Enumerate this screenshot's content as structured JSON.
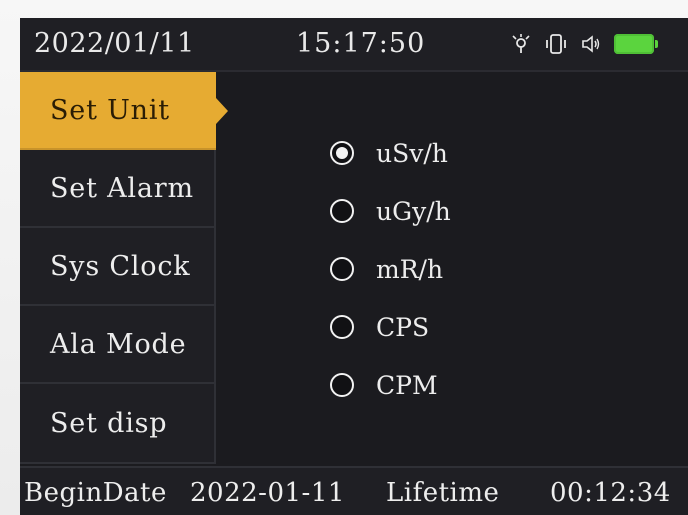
{
  "status_bar": {
    "date": "2022/01/11",
    "time": "15:17:50",
    "icons": [
      "light-icon",
      "vibrate-icon",
      "speaker-icon",
      "battery-icon"
    ],
    "battery_color": "#5bd43e"
  },
  "menu": {
    "items": [
      {
        "label": "Set Unit",
        "active": true
      },
      {
        "label": "Set Alarm",
        "active": false
      },
      {
        "label": "Sys Clock",
        "active": false
      },
      {
        "label": "Ala Mode",
        "active": false
      },
      {
        "label": "Set disp",
        "active": false
      }
    ],
    "accent_color": "#e6ab32"
  },
  "unit_options": [
    {
      "label": "uSv/h",
      "selected": true
    },
    {
      "label": "uGy/h",
      "selected": false
    },
    {
      "label": "mR/h",
      "selected": false
    },
    {
      "label": "CPS",
      "selected": false
    },
    {
      "label": "CPM",
      "selected": false
    }
  ],
  "footer": {
    "begin_label": "BeginDate",
    "begin_date": "2022-01-11",
    "lifetime_label": "Lifetime",
    "lifetime_value": "00:12:34"
  }
}
